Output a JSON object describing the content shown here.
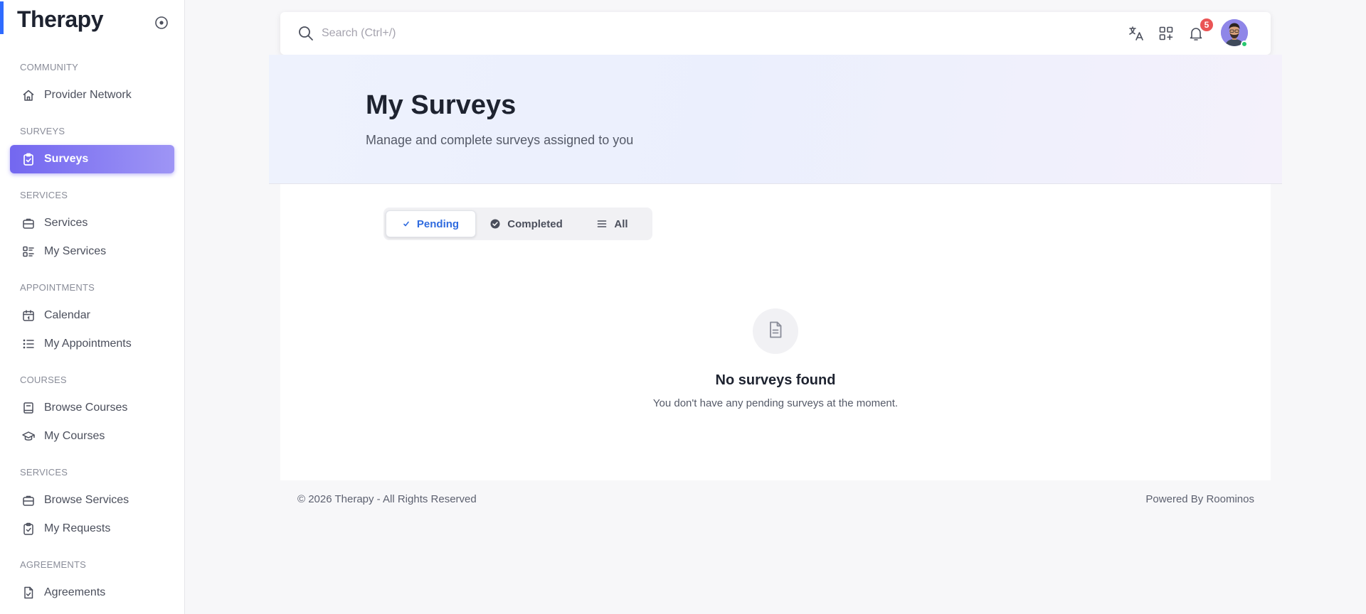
{
  "app": {
    "name": "Therapy"
  },
  "sidebar": {
    "sections": [
      {
        "label": "COMMUNITY",
        "items": [
          {
            "label": "Provider Network",
            "icon": "home-icon"
          }
        ]
      },
      {
        "label": "SURVEYS",
        "items": [
          {
            "label": "Surveys",
            "icon": "clipboard-check-icon",
            "active": true
          }
        ]
      },
      {
        "label": "SERVICES",
        "items": [
          {
            "label": "Services",
            "icon": "briefcase-icon"
          },
          {
            "label": "My Services",
            "icon": "list-details-icon"
          }
        ]
      },
      {
        "label": "APPOINTMENTS",
        "items": [
          {
            "label": "Calendar",
            "icon": "calendar-icon"
          },
          {
            "label": "My Appointments",
            "icon": "list-icon"
          }
        ]
      },
      {
        "label": "COURSES",
        "items": [
          {
            "label": "Browse Courses",
            "icon": "book-icon"
          },
          {
            "label": "My Courses",
            "icon": "graduation-cap-icon"
          }
        ]
      },
      {
        "label": "SERVICES",
        "items": [
          {
            "label": "Browse Services",
            "icon": "briefcase-icon"
          },
          {
            "label": "My Requests",
            "icon": "clipboard-check-icon"
          }
        ]
      },
      {
        "label": "AGREEMENTS",
        "items": [
          {
            "label": "Agreements",
            "icon": "file-check-icon"
          }
        ]
      }
    ]
  },
  "navbar": {
    "search_placeholder": "Search (Ctrl+/)",
    "notification_count": "5"
  },
  "header": {
    "title": "My Surveys",
    "subtitle": "Manage and complete surveys assigned to you"
  },
  "tabs": [
    {
      "label": "Pending",
      "icon": "check-icon",
      "active": true
    },
    {
      "label": "Completed",
      "icon": "check-circle-icon",
      "active": false
    },
    {
      "label": "All",
      "icon": "menu-icon",
      "active": false
    }
  ],
  "empty_state": {
    "title": "No surveys found",
    "description": "You don't have any pending surveys at the moment."
  },
  "footer": {
    "copyright": "© 2026 Therapy - All Rights Reserved",
    "powered_by": "Powered By Roominos"
  },
  "colors": {
    "accent": "#7367f0",
    "brand_bar": "#2f6bff",
    "active_tab_text": "#2f6bdf",
    "badge": "#ea5455",
    "online": "#28c76f"
  }
}
